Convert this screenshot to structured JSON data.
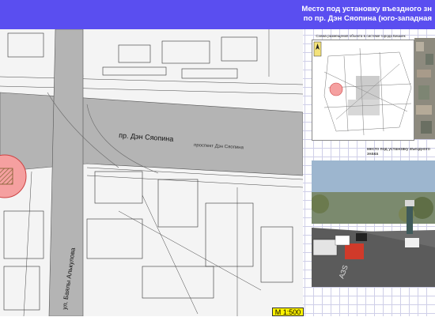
{
  "header": {
    "title_line1": "Место под установку въездного зн",
    "title_line2": "по пр. Дэн Сяопина (юго-западная",
    "background_color": "#5a4ef0"
  },
  "map": {
    "street_labels": [
      "пр. Дэн Сяопина",
      "проспект  Дэн  Сяопина",
      "ул. Баялы Алькулова"
    ],
    "marker_color": "#f5a0a0",
    "road_color": "#b4b4b4",
    "scale_label": "М 1:500"
  },
  "scheme": {
    "title": "Схема размещения объекта в системе города Бишкек"
  },
  "photo": {
    "caption": "место под установку въездного знака"
  }
}
